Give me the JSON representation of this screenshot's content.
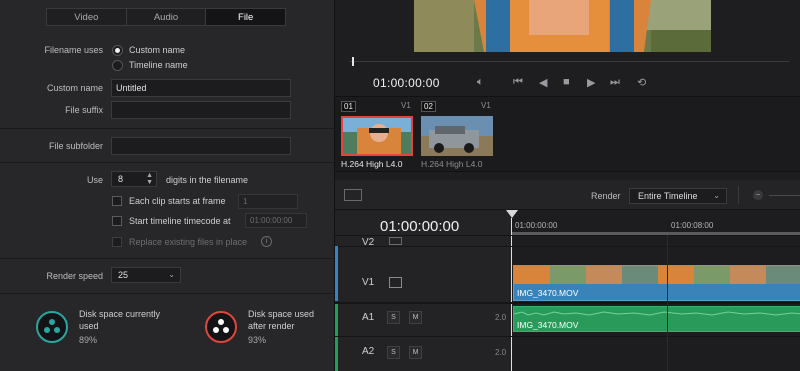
{
  "tabs": [
    {
      "label": "Video",
      "active": false
    },
    {
      "label": "Audio",
      "active": false
    },
    {
      "label": "File",
      "active": true
    }
  ],
  "file": {
    "filename_uses_label": "Filename uses",
    "option_custom": "Custom name",
    "option_timeline": "Timeline name",
    "custom_name_label": "Custom name",
    "custom_name_value": "Untitled",
    "file_suffix_label": "File suffix",
    "file_suffix_value": "",
    "subfolder_label": "File subfolder",
    "subfolder_value": "",
    "use_label": "Use",
    "digits_value": "8",
    "digits_label": "digits in the filename",
    "each_clip_label": "Each clip starts at frame",
    "each_clip_value": "1",
    "start_tc_label": "Start timeline timecode at",
    "start_tc_value": "01:00:00:00",
    "replace_label": "Replace existing files in place",
    "render_speed_label": "Render speed",
    "render_speed_value": "25"
  },
  "disk": {
    "current_label_1": "Disk space currently",
    "current_label_2": "used",
    "current_value": "89%",
    "after_label_1": "Disk space used",
    "after_label_2": "after render",
    "after_value": "93%",
    "current_color": "#2aa7a0",
    "after_color": "#e0463c"
  },
  "viewer": {
    "timecode": "01:00:00:00"
  },
  "clips": [
    {
      "num": "01",
      "track": "V1",
      "codec": "H.264 High L4.0",
      "selected": true
    },
    {
      "num": "02",
      "track": "V1",
      "codec": "H.264 High L4.0",
      "selected": false
    }
  ],
  "timeline": {
    "render_label": "Render",
    "render_value": "Entire Timeline",
    "timecode": "01:00:00:00",
    "ruler": [
      "01:00:00:00",
      "01:00:08:00"
    ],
    "tracks": {
      "v2": "V2",
      "v1": "V1",
      "a1": "A1",
      "a2": "A2",
      "solo": "S",
      "mute": "M",
      "a1_vol": "2.0",
      "a2_vol": "2.0"
    },
    "video_clip_name": "IMG_3470.MOV",
    "audio_clip_name": "IMG_3470.MOV",
    "video_color": "#3a83b8",
    "audio_color": "#2a9a5a"
  }
}
